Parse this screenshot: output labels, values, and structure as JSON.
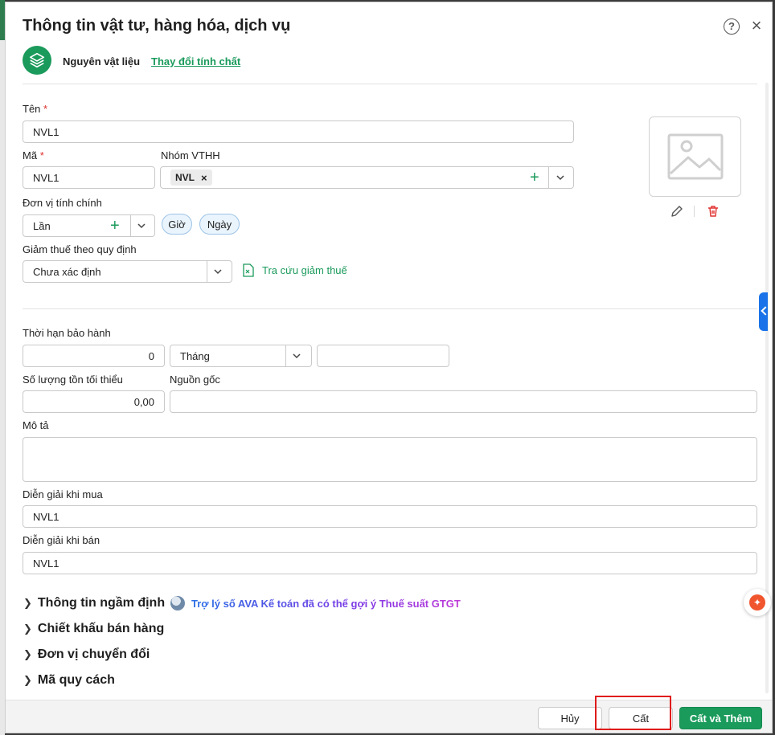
{
  "dialog": {
    "title": "Thông tin vật tư, hàng hóa, dịch vụ",
    "type_label": "Nguyên vật liệu",
    "change_link": "Thay đổi tính chất"
  },
  "form": {
    "ten": {
      "label": "Tên",
      "required": "*",
      "value": "NVL1"
    },
    "ma": {
      "label": "Mã",
      "required": "*",
      "value": "NVL1"
    },
    "nhom": {
      "label": "Nhóm VTHH",
      "chip": "NVL",
      "chip_remove": "×"
    },
    "don_vi": {
      "label": "Đơn vị tính chính",
      "value": "Lần",
      "suggestions": [
        "Giờ",
        "Ngày"
      ]
    },
    "giam_thue": {
      "label": "Giảm thuế theo quy định",
      "value": "Chưa xác định",
      "lookup": "Tra cứu giảm thuế"
    },
    "bao_hanh": {
      "label": "Thời hạn bảo hành",
      "number": "0",
      "unit": "Tháng",
      "extra": ""
    },
    "ton_toi_thieu": {
      "label": "Số lượng tồn tối thiểu",
      "value": "0,00"
    },
    "nguon_goc": {
      "label": "Nguồn gốc",
      "value": ""
    },
    "mo_ta": {
      "label": "Mô tả",
      "value": ""
    },
    "dien_giai_mua": {
      "label": "Diễn giải khi mua",
      "value": "NVL1"
    },
    "dien_giai_ban": {
      "label": "Diễn giải khi bán",
      "value": "NVL1"
    }
  },
  "sections": [
    {
      "label": "Thông tin ngầm định"
    },
    {
      "label": "Chiết khấu bán hàng"
    },
    {
      "label": "Đơn vị chuyển đổi"
    },
    {
      "label": "Mã quy cách"
    }
  ],
  "ava_hint": "Trợ lý số AVA Kế toán đã có thể gợi ý Thuế suất GTGT",
  "footer": {
    "cancel": "Hủy",
    "save": "Cất",
    "save_and_add": "Cất và Thêm"
  },
  "colors": {
    "brand_green": "#1a9a5b",
    "required_red": "#e0312e",
    "highlight_red": "#e01b1b",
    "side_tab_blue": "#1a73e8"
  }
}
